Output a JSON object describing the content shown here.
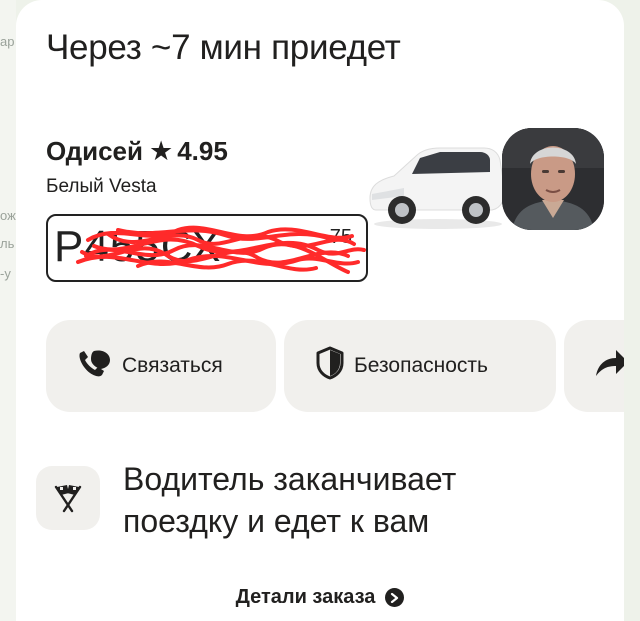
{
  "map": {
    "labels": [
      "ар",
      "ож",
      "ль",
      "-у"
    ]
  },
  "order": {
    "headline": "Через ~7 мин приедет",
    "driver": {
      "name": "Одисей",
      "rating": "4.95"
    },
    "car": {
      "model": "Белый Vesta",
      "plate_number": "Р455СХ",
      "plate_region": "75",
      "plate_obscured": true
    }
  },
  "actions": {
    "contact_label": "Связаться",
    "safety_label": "Безопасность"
  },
  "status": {
    "text": "Водитель заканчивает поездку и едет к вам"
  },
  "footer": {
    "details_label": "Детали заказа"
  },
  "colors": {
    "card_bg": "#ffffff",
    "button_bg": "#f1f0ed",
    "text": "#21201f",
    "scribble": "#ff2a2a",
    "map_bg": "#eef2ea"
  },
  "icons": {
    "star": "star-icon",
    "contact": "phone-chat-icon",
    "safety": "shield-icon",
    "share": "share-arrow-icon",
    "status": "finish-flags-icon",
    "details": "chevron-right-circle-icon"
  }
}
